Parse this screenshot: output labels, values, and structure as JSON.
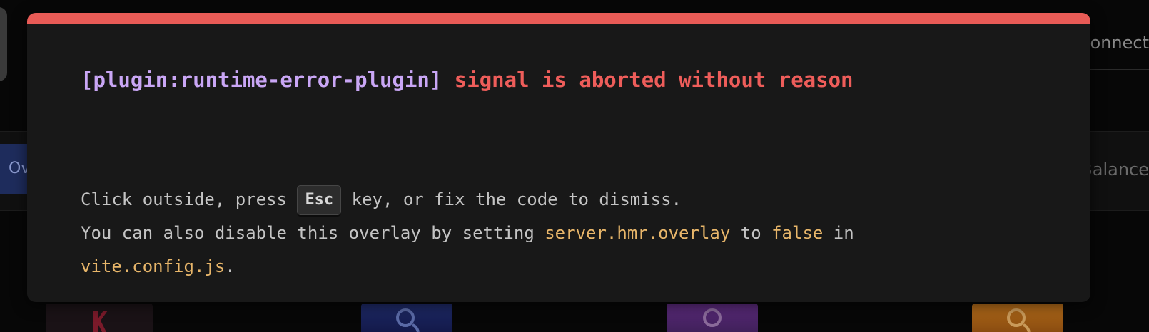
{
  "background": {
    "left_tab_label": "Ov",
    "right_top_text": "Disconnect",
    "right_mid_text": "Balance"
  },
  "overlay": {
    "plugin": "[plugin:runtime-error-plugin]",
    "message": "signal is aborted without reason",
    "tip": {
      "part1": "Click outside, press ",
      "key": "Esc",
      "part2": " key, or fix the code to dismiss.",
      "part3": "You can also disable this overlay by setting ",
      "setting": "server.hmr.overlay",
      "part4": " to ",
      "value": "false",
      "part5": " in",
      "file": "vite.config.js",
      "part6": "."
    },
    "colors": {
      "accent_bar": "#e85b56",
      "plugin_text": "#c9a6f5",
      "error_text": "#ee5d5a",
      "code_text": "#e8b66a"
    }
  }
}
